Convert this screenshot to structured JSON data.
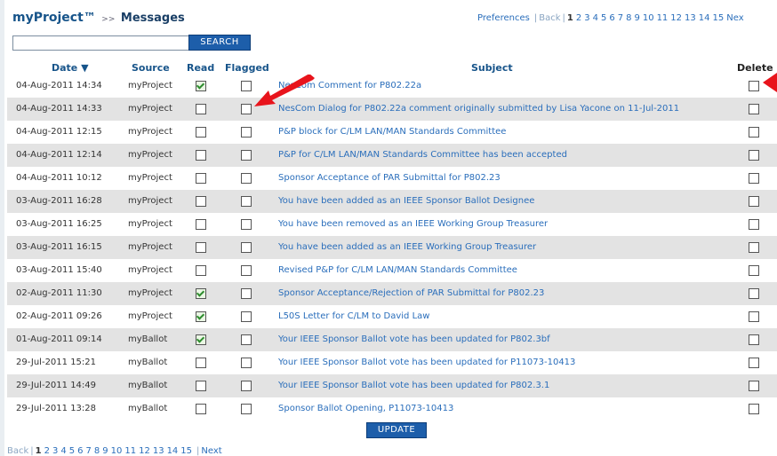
{
  "header": {
    "brand": "myProject™",
    "separator": ">>",
    "page_title": "Messages"
  },
  "pager": {
    "preferences": "Preferences",
    "back": "Back",
    "divider": "|",
    "current": "1",
    "pages": [
      "2",
      "3",
      "4",
      "5",
      "6",
      "7",
      "8",
      "9",
      "10",
      "11",
      "12",
      "13",
      "14",
      "15"
    ],
    "next_top": "Nex",
    "next": "Next"
  },
  "search": {
    "value": "",
    "button_label": "SEARCH"
  },
  "table": {
    "headers": {
      "date": "Date ▼",
      "source": "Source",
      "read": "Read",
      "flagged": "Flagged",
      "subject": "Subject",
      "delete": "Delete"
    },
    "rows": [
      {
        "date": "04-Aug-2011 14:34",
        "source": "myProject",
        "read": true,
        "flagged": false,
        "subject": "NesCom Comment for P802.22a",
        "delete": false
      },
      {
        "date": "04-Aug-2011 14:33",
        "source": "myProject",
        "read": false,
        "flagged": false,
        "subject": "NesCom Dialog for P802.22a comment originally submitted by Lisa Yacone on 11-Jul-2011",
        "delete": false
      },
      {
        "date": "04-Aug-2011 12:15",
        "source": "myProject",
        "read": false,
        "flagged": false,
        "subject": "P&P block for C/LM LAN/MAN Standards Committee",
        "delete": false
      },
      {
        "date": "04-Aug-2011 12:14",
        "source": "myProject",
        "read": false,
        "flagged": false,
        "subject": "P&P for C/LM LAN/MAN Standards Committee has been accepted",
        "delete": false
      },
      {
        "date": "04-Aug-2011 10:12",
        "source": "myProject",
        "read": false,
        "flagged": false,
        "subject": "Sponsor Acceptance of PAR Submittal for P802.23",
        "delete": false
      },
      {
        "date": "03-Aug-2011 16:28",
        "source": "myProject",
        "read": false,
        "flagged": false,
        "subject": "You have been added as an IEEE Sponsor Ballot Designee",
        "delete": false
      },
      {
        "date": "03-Aug-2011 16:25",
        "source": "myProject",
        "read": false,
        "flagged": false,
        "subject": "You have been removed as an IEEE Working Group Treasurer",
        "delete": false
      },
      {
        "date": "03-Aug-2011 16:15",
        "source": "myProject",
        "read": false,
        "flagged": false,
        "subject": "You have been added as an IEEE Working Group Treasurer",
        "delete": false
      },
      {
        "date": "03-Aug-2011 15:40",
        "source": "myProject",
        "read": false,
        "flagged": false,
        "subject": "Revised P&P for C/LM LAN/MAN Standards Committee",
        "delete": false
      },
      {
        "date": "02-Aug-2011 11:30",
        "source": "myProject",
        "read": true,
        "flagged": false,
        "subject": "Sponsor Acceptance/Rejection of PAR Submittal for P802.23",
        "delete": false
      },
      {
        "date": "02-Aug-2011 09:26",
        "source": "myProject",
        "read": true,
        "flagged": false,
        "subject": "L50S Letter for C/LM to David Law",
        "delete": false
      },
      {
        "date": "01-Aug-2011 09:14",
        "source": "myBallot",
        "read": true,
        "flagged": false,
        "subject": "Your IEEE Sponsor Ballot vote has been updated for P802.3bf",
        "delete": false
      },
      {
        "date": "29-Jul-2011 15:21",
        "source": "myBallot",
        "read": false,
        "flagged": false,
        "subject": "Your IEEE Sponsor Ballot vote has been updated for P11073-10413",
        "delete": false
      },
      {
        "date": "29-Jul-2011 14:49",
        "source": "myBallot",
        "read": false,
        "flagged": false,
        "subject": "Your IEEE Sponsor Ballot vote has been updated for P802.3.1",
        "delete": false
      },
      {
        "date": "29-Jul-2011 13:28",
        "source": "myBallot",
        "read": false,
        "flagged": false,
        "subject": "Sponsor Ballot Opening, P11073-10413",
        "delete": false
      }
    ]
  },
  "update_button": {
    "label": "UPDATE"
  },
  "arrows": [
    "red-arrow-icon",
    "red-arrow-icon"
  ],
  "colors": {
    "brand": "#17548a",
    "link": "#2a6ebb",
    "button": "#1d5eaa",
    "row_shade": "#e3e3e3",
    "arrow": "#e8141c",
    "check": "#2e8c2e"
  }
}
